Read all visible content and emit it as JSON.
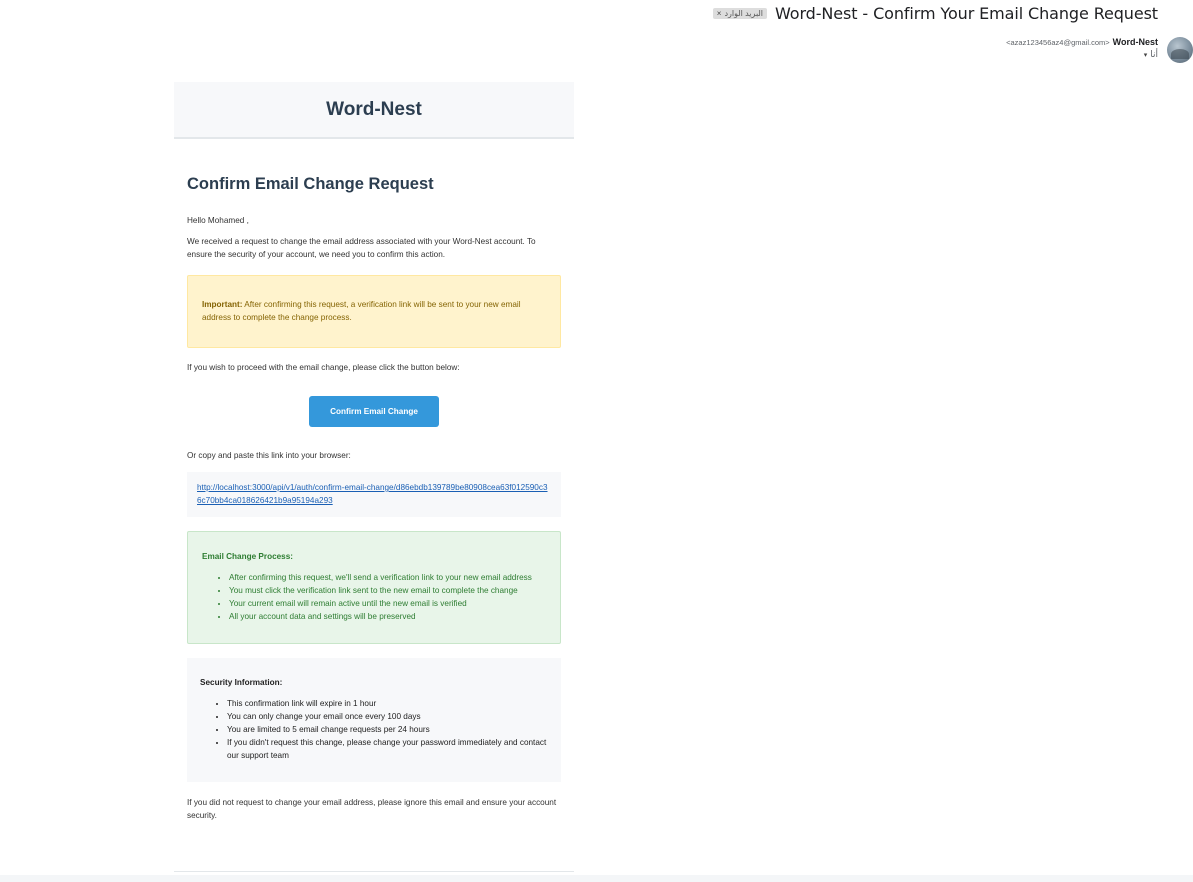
{
  "gmail": {
    "subject": "Word-Nest - Confirm Your Email Change Request",
    "label_chip": "البريد الوارد",
    "label_chip_close": "×",
    "sender_name": "Word-Nest",
    "sender_email": "<azaz123456az4@gmail.com>",
    "to": "أنا",
    "to_caret": "▾"
  },
  "email": {
    "brand": "Word-Nest",
    "title": "Confirm Email Change Request",
    "greeting": "Hello Mohamed ,",
    "intro": "We received a request to change the email address associated with your Word-Nest account. To ensure the security of your account, we need you to confirm this action.",
    "important_label": "Important:",
    "important_text": " After confirming this request, a verification link will be sent to your new email address to complete the change process.",
    "proceed_text": "If you wish to proceed with the email change, please click the button below:",
    "button_label": "Confirm Email Change",
    "copy_text": "Or copy and paste this link into your browser:",
    "link": "http://localhost:3000/api/v1/auth/confirm-email-change/d86ebdb139789be80908cea63f012590c36c70bb4ca018626421b9a95194a293",
    "process": {
      "title": "Email Change Process:",
      "items": [
        "After confirming this request, we'll send a verification link to your new email address",
        "You must click the verification link sent to the new email to complete the change",
        "Your current email will remain active until the new email is verified",
        "All your account data and settings will be preserved"
      ]
    },
    "security": {
      "title": "Security Information:",
      "items": [
        "This confirmation link will expire in 1 hour",
        "You can only change your email once every 100 days",
        "You are limited to 5 email change requests per 24 hours",
        "If you didn't request this change, please change your password immediately and contact our support team"
      ]
    },
    "footer_note": "If you did not request to change your email address, please ignore this email and ensure your account security."
  },
  "colors": {
    "brand_text": "#2c3e50",
    "button": "#3498db",
    "warning_bg": "#fff3cd",
    "warning_text": "#856404",
    "success_bg": "#e8f5e9",
    "success_text": "#2e7d32",
    "link": "#1a5fb4"
  }
}
